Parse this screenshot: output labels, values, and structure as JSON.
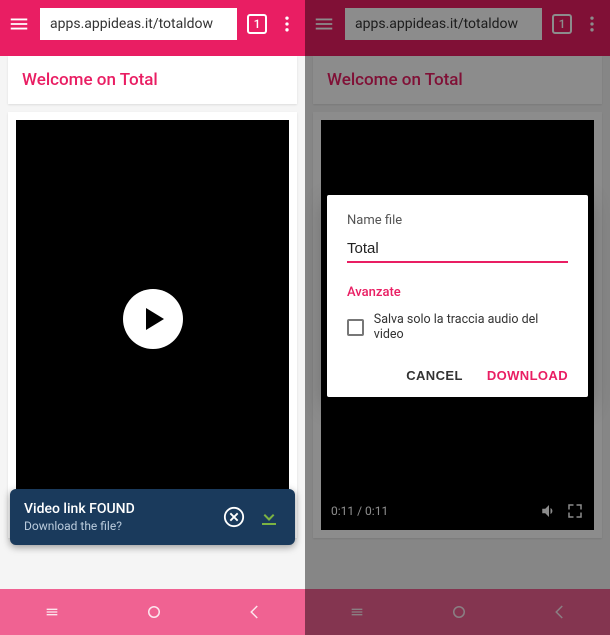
{
  "browser": {
    "url": "apps.appideas.it/totaldow",
    "tab_count": "1"
  },
  "page": {
    "welcome_title": "Welcome on Total"
  },
  "video": {
    "time_display": "0:11 / 0:11"
  },
  "snackbar": {
    "title": "Video link FOUND",
    "subtitle": "Download the file?"
  },
  "dialog": {
    "field_label": "Name file",
    "file_name": "Total",
    "advanced_label": "Avanzate",
    "audio_only_label": "Salva solo la traccia audio del video",
    "cancel": "CANCEL",
    "download": "DOWNLOAD"
  }
}
